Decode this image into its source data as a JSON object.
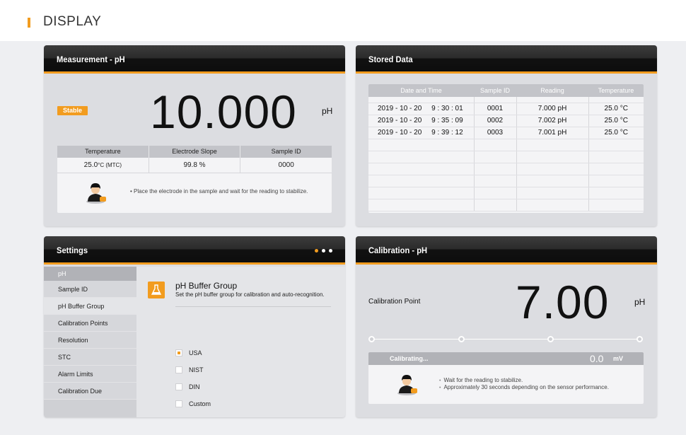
{
  "page": {
    "title": "DISPLAY"
  },
  "colors": {
    "accent": "#f29c1f",
    "panel_header": "#1e1e1e",
    "panel_bg": "#dcdde1"
  },
  "measurement": {
    "title": "Measurement - pH",
    "badge": "Stable",
    "value": "10.000",
    "unit": "pH",
    "headers": [
      "Temperature",
      "Electrode Slope",
      "Sample ID"
    ],
    "temperature": "25.0",
    "temperature_unit": "°C (MTC)",
    "slope": "99.8 %",
    "sample_id": "0000",
    "hint": "Place the electrode in the sample and wait for the reading to stabilize.",
    "avatar_icon": "operator-avatar-icon"
  },
  "stored": {
    "title": "Stored Data",
    "headers": [
      "Date and Time",
      "Sample ID",
      "Reading",
      "Temperature"
    ],
    "rows": [
      {
        "datetime": "2019 - 10 - 20     9 : 30 : 01",
        "sample_id": "0001",
        "reading": "7.000 pH",
        "temperature": "25.0 °C"
      },
      {
        "datetime": "2019 - 10 - 20     9 : 35 : 09",
        "sample_id": "0002",
        "reading": "7.002 pH",
        "temperature": "25.0 °C"
      },
      {
        "datetime": "2019 - 10 - 20     9 : 39 : 12",
        "sample_id": "0003",
        "reading": "7.001 pH",
        "temperature": "25.0 °C"
      }
    ]
  },
  "settings": {
    "title": "Settings",
    "sidebar_category": "pH",
    "sidebar_items": [
      "Sample ID",
      "pH Buffer Group",
      "Calibration Points",
      "Resolution",
      "STC",
      "Alarm Limits",
      "Calibration Due"
    ],
    "active_item": "pH Buffer Group",
    "group_title": "pH Buffer Group",
    "group_desc": "Set the pH buffer group for calibration and auto-recognition.",
    "options": [
      {
        "label": "USA",
        "checked": true
      },
      {
        "label": "NIST",
        "checked": false
      },
      {
        "label": "DIN",
        "checked": false
      },
      {
        "label": "Custom",
        "checked": false
      }
    ]
  },
  "calibration": {
    "title": "Calibration - pH",
    "point_label": "Calibration Point",
    "value": "7.00",
    "unit": "pH",
    "status": "Calibrating...",
    "mv_value": "0.0",
    "mv_unit": "mV",
    "hints": [
      "Wait for the reading to stabilize.",
      "Approximately 30 seconds depending on the sensor performance."
    ]
  }
}
